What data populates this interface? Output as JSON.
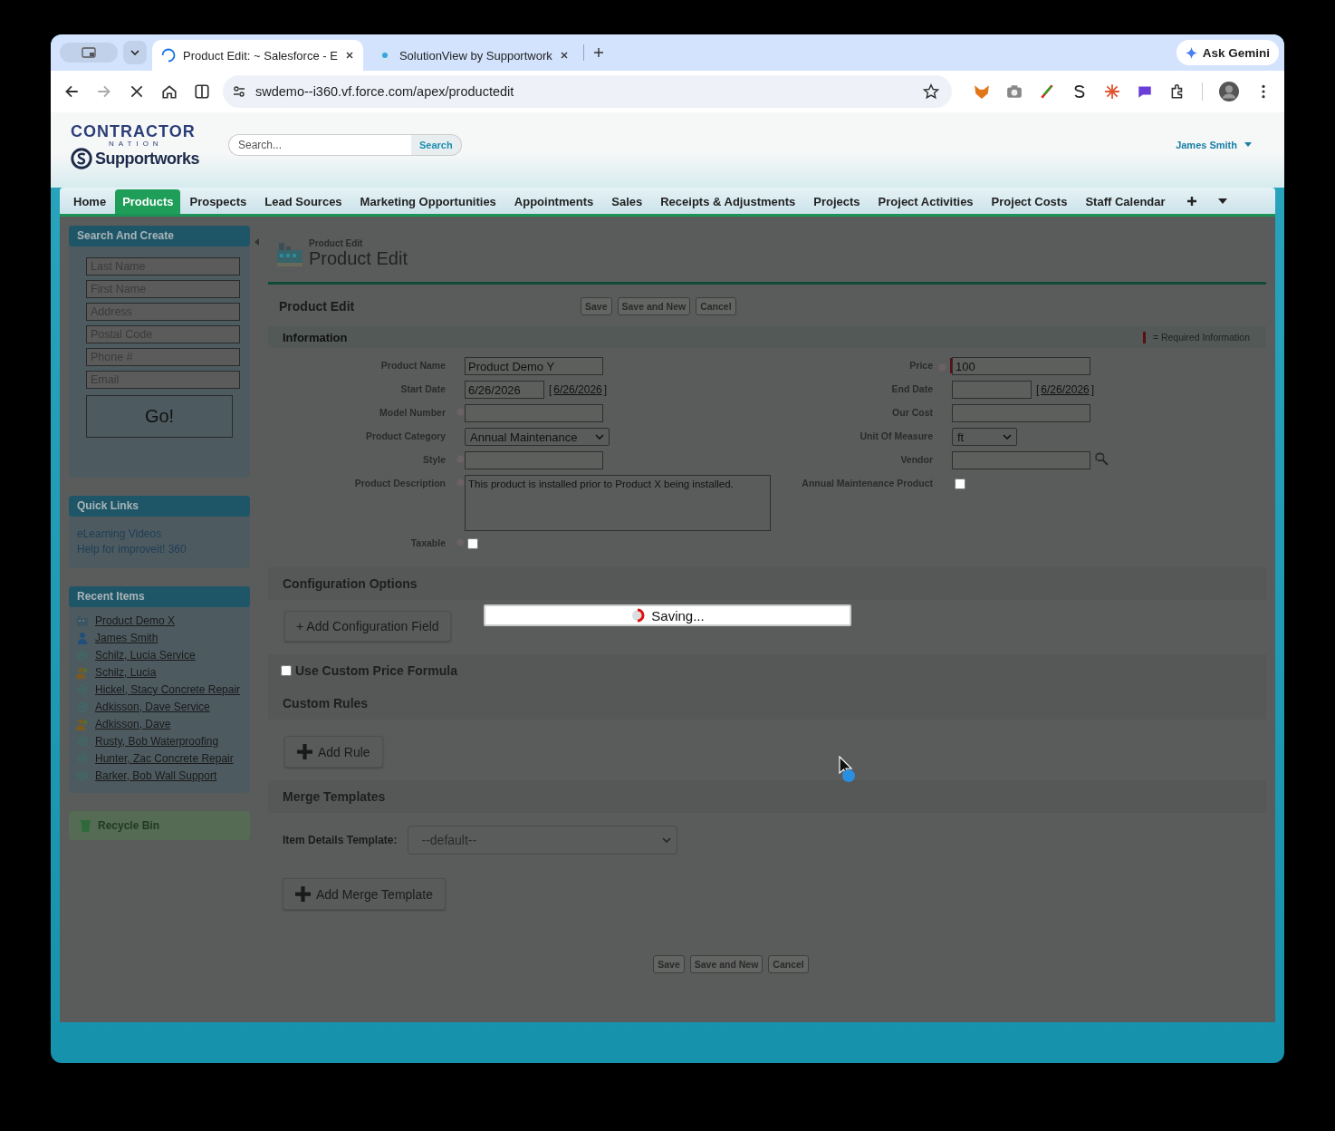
{
  "browser": {
    "tabs": [
      {
        "title": "Product Edit: ~ Salesforce - E",
        "selected": true,
        "loading": true
      },
      {
        "title": "SolutionView by Supportwork",
        "selected": false,
        "loading": false
      }
    ],
    "ask_gemini": "Ask Gemini",
    "url": "swdemo--i360.vf.force.com/apex/productedit"
  },
  "header": {
    "logo_top": "CONTRACTOR",
    "logo_mid": "NATION",
    "logo_brand": "Supportworks",
    "search_placeholder": "Search...",
    "search_button": "Search",
    "user": "James Smith"
  },
  "nav_tabs": [
    {
      "label": "Home",
      "selected": false
    },
    {
      "label": "Products",
      "selected": true
    },
    {
      "label": "Prospects",
      "selected": false
    },
    {
      "label": "Lead Sources",
      "selected": false
    },
    {
      "label": "Marketing Opportunities",
      "selected": false
    },
    {
      "label": "Appointments",
      "selected": false
    },
    {
      "label": "Sales",
      "selected": false
    },
    {
      "label": "Receipts & Adjustments",
      "selected": false
    },
    {
      "label": "Projects",
      "selected": false
    },
    {
      "label": "Project Activities",
      "selected": false
    },
    {
      "label": "Project Costs",
      "selected": false
    },
    {
      "label": "Staff Calendar",
      "selected": false
    }
  ],
  "sidebar": {
    "search_and_create": {
      "title": "Search And Create",
      "fields": [
        {
          "placeholder": "Last Name"
        },
        {
          "placeholder": "First Name"
        },
        {
          "placeholder": "Address"
        },
        {
          "placeholder": "Postal Code"
        },
        {
          "placeholder": "Phone #"
        },
        {
          "placeholder": "Email"
        }
      ],
      "go_button": "Go!"
    },
    "quick_links": {
      "title": "Quick Links",
      "links": [
        "eLearning Videos",
        "Help for improveit! 360"
      ]
    },
    "recent_items": {
      "title": "Recent Items",
      "items": [
        {
          "label": "Product Demo X",
          "kind": "product"
        },
        {
          "label": "James Smith",
          "kind": "person"
        },
        {
          "label": "Schilz, Lucia Service",
          "kind": "service"
        },
        {
          "label": "Schilz, Lucia",
          "kind": "account"
        },
        {
          "label": "Hickel, Stacy Concrete Repair",
          "kind": "service"
        },
        {
          "label": "Adkisson, Dave Service",
          "kind": "service"
        },
        {
          "label": "Adkisson, Dave",
          "kind": "account"
        },
        {
          "label": "Rusty, Bob Waterproofing",
          "kind": "service"
        },
        {
          "label": "Hunter, Zac Concrete Repair",
          "kind": "service"
        },
        {
          "label": "Barker, Bob Wall Support",
          "kind": "service"
        }
      ]
    },
    "recycle_bin": "Recycle Bin"
  },
  "main": {
    "breadcrumb": "Product Edit",
    "title": "Product Edit",
    "section_title": "Product Edit",
    "buttons": [
      "Save",
      "Save and New",
      "Cancel"
    ],
    "information": {
      "title": "Information",
      "required_legend": "= Required Information",
      "left_fields": [
        {
          "label": "Product Name",
          "kind": "text",
          "value": "Product Demo Y"
        },
        {
          "label": "Start Date",
          "kind": "date",
          "value": "6/26/2026",
          "today_link": "6/26/2026",
          "bracket_open": "[",
          "bracket_close": "]"
        },
        {
          "label": "Model Number",
          "kind": "text",
          "help_icon": true
        },
        {
          "label": "Product Category",
          "kind": "select",
          "value": "Annual Maintenance"
        },
        {
          "label": "Style",
          "kind": "text",
          "help_icon": true
        },
        {
          "label": "Product Description",
          "kind": "textarea",
          "value": "This product is installed prior to Product X being installed.",
          "help_icon": true
        },
        {
          "label": "Taxable",
          "kind": "checkbox",
          "checked": false,
          "help_icon": true
        }
      ],
      "right_fields": [
        {
          "label": "Price",
          "kind": "text",
          "value": "100",
          "required": true,
          "help_icon": true
        },
        {
          "label": "End Date",
          "kind": "date",
          "today_link": "6/26/2026",
          "bracket_open": "[",
          "bracket_close": "]"
        },
        {
          "label": "Our Cost",
          "kind": "text"
        },
        {
          "label": "Unit Of Measure",
          "kind": "select",
          "value": "ft"
        },
        {
          "label": "Vendor",
          "kind": "lookup"
        },
        {
          "label": "Annual Maintenance Product",
          "kind": "checkbox",
          "checked": false
        }
      ]
    },
    "configuration": {
      "title": "Configuration Options",
      "add_button": "+ Add Configuration Field"
    },
    "custom_price_formula": {
      "label": "Use Custom Price Formula",
      "checked": false
    },
    "custom_rules": {
      "title": "Custom Rules",
      "add_button": "Add Rule"
    },
    "merge_templates": {
      "title": "Merge Templates",
      "template_label": "Item Details Template:",
      "template_value": "--default--",
      "add_button": "Add Merge Template"
    },
    "bottom_buttons": [
      "Save",
      "Save and New",
      "Cancel"
    ],
    "saving": "Saving..."
  }
}
